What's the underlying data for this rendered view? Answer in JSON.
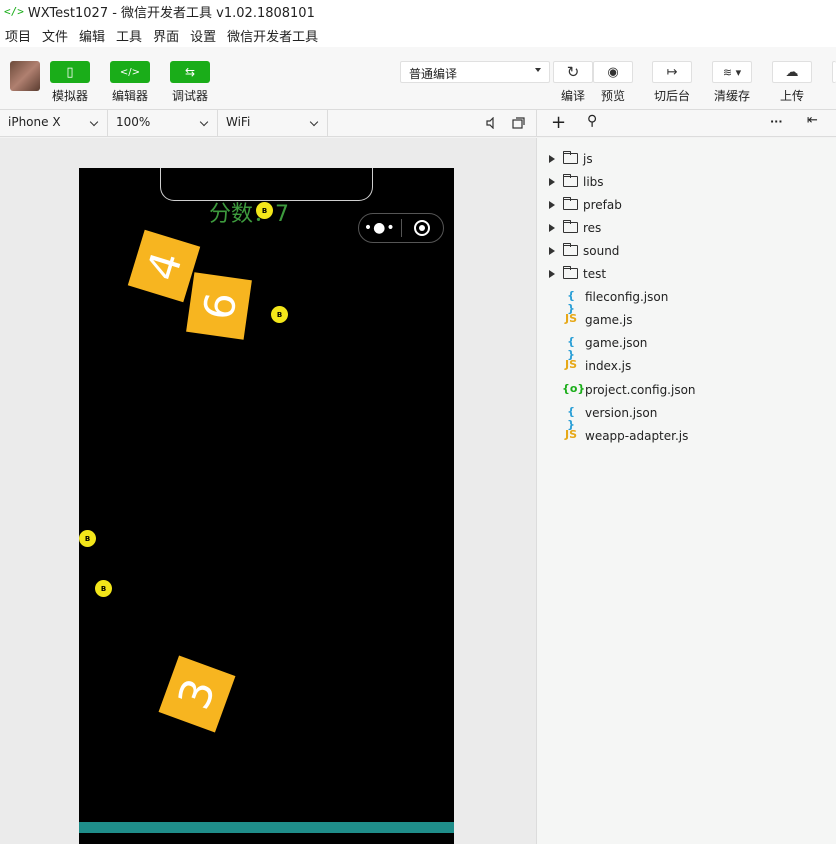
{
  "window": {
    "title": "WXTest1027 - 微信开发者工具 v1.02.1808101",
    "logo_glyph": "</>"
  },
  "menu": [
    "项目",
    "文件",
    "编辑",
    "工具",
    "界面",
    "设置",
    "微信开发者工具"
  ],
  "toolbar": {
    "modes": [
      {
        "label": "模拟器",
        "icon": "phone-icon",
        "glyph": "▯"
      },
      {
        "label": "编辑器",
        "icon": "code-icon",
        "glyph": "</>"
      },
      {
        "label": "调试器",
        "icon": "debug-icon",
        "glyph": "⇆"
      }
    ],
    "compile_mode": "普通编译",
    "actions": [
      {
        "label": "编译",
        "icon": "refresh-icon",
        "glyph": "↻"
      },
      {
        "label": "预览",
        "icon": "eye-icon",
        "glyph": "◉"
      },
      {
        "label": "切后台",
        "icon": "background-icon",
        "glyph": "↦"
      },
      {
        "label": "清缓存",
        "icon": "layers-icon",
        "glyph": "≋ ▾"
      },
      {
        "label": "上传",
        "icon": "cloud-upload-icon",
        "glyph": "☁"
      }
    ],
    "accent_color": "#1aad19"
  },
  "device_bar": {
    "device": "iPhone X",
    "zoom": "100%",
    "network": "WiFi"
  },
  "simulator": {
    "score_text": "分数：7",
    "tiles": [
      "4",
      "9",
      "3"
    ],
    "ball_label": "B",
    "capsule_dots": "•●•"
  },
  "file_toolbar": {
    "add_glyph": "+",
    "search_glyph": "⚲",
    "more_glyph": "···",
    "collapse_glyph": "⇤"
  },
  "files": {
    "folders": [
      "js",
      "libs",
      "prefab",
      "res",
      "sound",
      "test"
    ],
    "items": [
      {
        "name": "fileconfig.json",
        "icon": "{ }",
        "kind": "json"
      },
      {
        "name": "game.js",
        "icon": "JS",
        "kind": "js"
      },
      {
        "name": "game.json",
        "icon": "{ }",
        "kind": "json"
      },
      {
        "name": "index.js",
        "icon": "JS",
        "kind": "js"
      },
      {
        "name": "project.config.json",
        "icon": "{o}",
        "kind": "config"
      },
      {
        "name": "version.json",
        "icon": "{ }",
        "kind": "json"
      },
      {
        "name": "weapp-adapter.js",
        "icon": "JS",
        "kind": "js"
      }
    ]
  }
}
